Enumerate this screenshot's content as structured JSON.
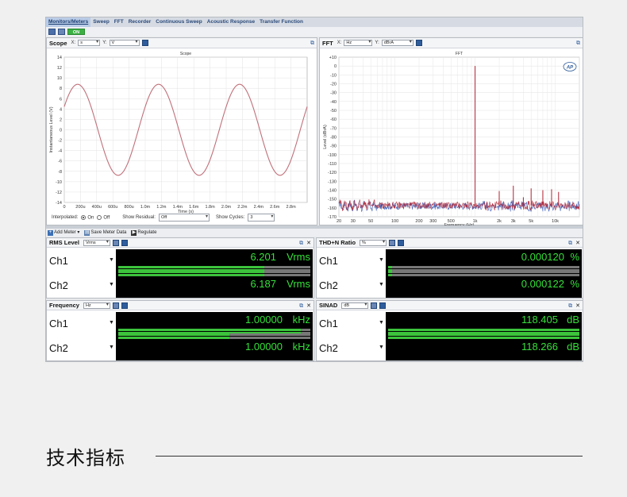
{
  "tabs": [
    "Monitors/Meters",
    "Sweep",
    "FFT",
    "Recorder",
    "Continuous Sweep",
    "Acoustic Response",
    "Transfer Function"
  ],
  "toolbar": {
    "on_label": "ON"
  },
  "scope": {
    "title": "Scope",
    "x_axis_label": "X:",
    "x_unit": "s",
    "y_axis_label": "Y:",
    "y_unit": "V",
    "plot_title": "Scope",
    "ylabel": "Instantaneous Level (V)",
    "xlabel": "Time (s)",
    "yticks": [
      "14",
      "12",
      "10",
      "8",
      "6",
      "4",
      "2",
      "0",
      "-2",
      "-4",
      "-6",
      "-8",
      "-10",
      "-12",
      "-14"
    ],
    "xticks": [
      "0",
      "200u",
      "400u",
      "600u",
      "800u",
      "1.0m",
      "1.2m",
      "1.4m",
      "1.6m",
      "1.8m",
      "2.0m",
      "2.2m",
      "2.4m",
      "2.6m",
      "2.8m"
    ],
    "interpolated_label": "Interpolated:",
    "on_label": "On",
    "off_label": "Off",
    "show_residual_label": "Show Residual:",
    "show_residual_value": "Off",
    "show_cycles_label": "Show Cycles:",
    "show_cycles_value": "3"
  },
  "fft": {
    "title": "FFT",
    "x_axis_label": "X:",
    "x_unit": "Hz",
    "y_axis_label": "Y:",
    "y_unit": "dBrA",
    "plot_title": "FFT",
    "ylabel": "Level (dBrA)",
    "xlabel": "Frequency (Hz)",
    "logo": "AP",
    "yticks": [
      "+10",
      "0",
      "-10",
      "-20",
      "-30",
      "-40",
      "-50",
      "-60",
      "-70",
      "-80",
      "-90",
      "-100",
      "-110",
      "-120",
      "-130",
      "-140",
      "-150",
      "-160",
      "-170"
    ],
    "xticks": [
      "20",
      "30",
      "50",
      "100",
      "200",
      "300",
      "500",
      "1k",
      "2k",
      "3k",
      "5k",
      "10k"
    ]
  },
  "meter_bar": {
    "add_meter": "Add Meter",
    "save_meter": "Save Meter Data",
    "regulate": "Regulate"
  },
  "meters": [
    {
      "title": "RMS Level",
      "unit_select": "Vrms",
      "rows": [
        {
          "ch": "Ch1",
          "value": "6.201",
          "unit": "Vrms",
          "fill": 0.76
        },
        {
          "ch": "Ch2",
          "value": "6.187",
          "unit": "Vrms",
          "fill": 0.76
        }
      ]
    },
    {
      "title": "THD+N Ratio",
      "unit_select": "%",
      "rows": [
        {
          "ch": "Ch1",
          "value": "0.000120",
          "unit": "%",
          "fill": 0.02
        },
        {
          "ch": "Ch2",
          "value": "0.000122",
          "unit": "%",
          "fill": 0.02
        }
      ]
    },
    {
      "title": "Frequency",
      "unit_select": "Hz",
      "rows": [
        {
          "ch": "Ch1",
          "value": "1.00000",
          "unit": "kHz",
          "fill": 0.95
        },
        {
          "ch": "Ch2",
          "value": "1.00000",
          "unit": "kHz",
          "fill": 0.58
        }
      ]
    },
    {
      "title": "SINAD",
      "unit_select": "dB",
      "rows": [
        {
          "ch": "Ch1",
          "value": "118.405",
          "unit": "dB",
          "fill": 1.0
        },
        {
          "ch": "Ch2",
          "value": "118.266",
          "unit": "dB",
          "fill": 1.0
        }
      ]
    }
  ],
  "page_heading": "技术指标",
  "chart_data": [
    {
      "type": "line",
      "title": "Scope",
      "xlabel": "Time (s)",
      "ylabel": "Instantaneous Level (V)",
      "xlim": [
        0,
        0.003
      ],
      "ylim": [
        -14,
        14
      ],
      "grid": true,
      "series": [
        {
          "frequency_hz": 1000,
          "amplitude_v": 8.77,
          "color": "#c0707a"
        }
      ]
    },
    {
      "type": "line",
      "title": "FFT",
      "xlabel": "Frequency (Hz)",
      "ylabel": "Level (dBrA)",
      "xscale": "log",
      "xlim": [
        20,
        20000
      ],
      "ylim": [
        -170,
        10
      ],
      "grid": true,
      "series": [
        {
          "color": "#b02030",
          "peaks": [
            {
              "x": 1000,
              "y": 0
            },
            {
              "x": 2000,
              "y": -141
            },
            {
              "x": 3000,
              "y": -135
            },
            {
              "x": 4000,
              "y": -148
            },
            {
              "x": 5000,
              "y": -138
            },
            {
              "x": 7000,
              "y": -140
            },
            {
              "x": 9000,
              "y": -139
            },
            {
              "x": 11000,
              "y": -142
            }
          ],
          "noise_floor": -157
        },
        {
          "color": "#3050b0",
          "noise_floor": -158
        }
      ]
    }
  ]
}
